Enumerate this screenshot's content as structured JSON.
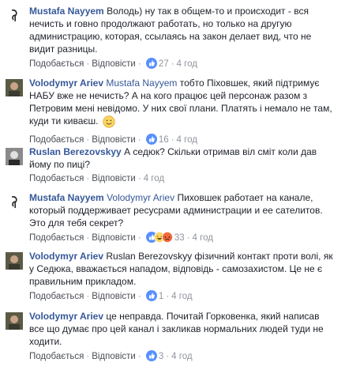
{
  "comments": [
    {
      "author": "Mustafa Nayyem",
      "mention": "",
      "text": "Володь) ну так в общем-то и происходит - вся нечисть и говно продолжают работать, но только на другую администрацию, которая, ссылаясь на закон делает вид, что не видит разницы.",
      "like_label": "Подобається",
      "reply_label": "Відповісти",
      "reactions": "27",
      "time": "4 год"
    },
    {
      "author": "Volodymyr Ariev",
      "mention": "Mustafa Nayyem",
      "text": "тобто Піховшек, який підтримує НАБУ вже не нечисть? А на кого працює цей персонаж разом з Петровим мені невідомо. У них свої плани. Платять і немало не там, куди ти киваєш.",
      "like_label": "Подобається",
      "reply_label": "Відповісти",
      "reactions": "16",
      "time": "4 год"
    },
    {
      "author": "Ruslan Berezovskyy",
      "mention": "",
      "text": "А седюк? Скільки отримав віл сміт коли дав йому по пиці?",
      "like_label": "Подобається",
      "reply_label": "Відповісти",
      "reactions": "",
      "time": "4 год"
    },
    {
      "author": "Mustafa Nayyem",
      "mention": "Volodymyr Ariev",
      "text": "Пиховшек работает на канале, который поддерживает ресусрами администрации и ее сателитов. Это для тебя секрет?",
      "like_label": "Подобається",
      "reply_label": "Відповісти",
      "reactions": "33",
      "time": "4 год"
    },
    {
      "author": "Volodymyr Ariev",
      "mention": "",
      "text": "Ruslan Berezovskyy фізичний контакт проти волі, як у Седюка, вважається нападом, відповідь - самозахистом. Це не є правильним прикладом.",
      "like_label": "Подобається",
      "reply_label": "Відповісти",
      "reactions": "1",
      "time": "4 год"
    },
    {
      "author": "Volodymyr Ariev",
      "mention": "",
      "text": "це неправда. Почитай Горковенка, який написав все що думає про цей канал і закликав нормальних людей туди не ходити.",
      "like_label": "Подобається",
      "reply_label": "Відповісти",
      "reactions": "3",
      "time": "4 год"
    }
  ],
  "colors": {
    "link": "#365899",
    "meta": "#90949c",
    "like_blue": "#5890ff",
    "love_red": "#f25268",
    "haha_yellow": "#fcd664"
  },
  "icons": {
    "reaction_like": "thumbs-up-icon",
    "reaction_love": "heart-icon",
    "reaction_haha": "laughing-face-icon",
    "reaction_angry": "angry-face-icon",
    "emoji": "smiley-face-icon"
  }
}
